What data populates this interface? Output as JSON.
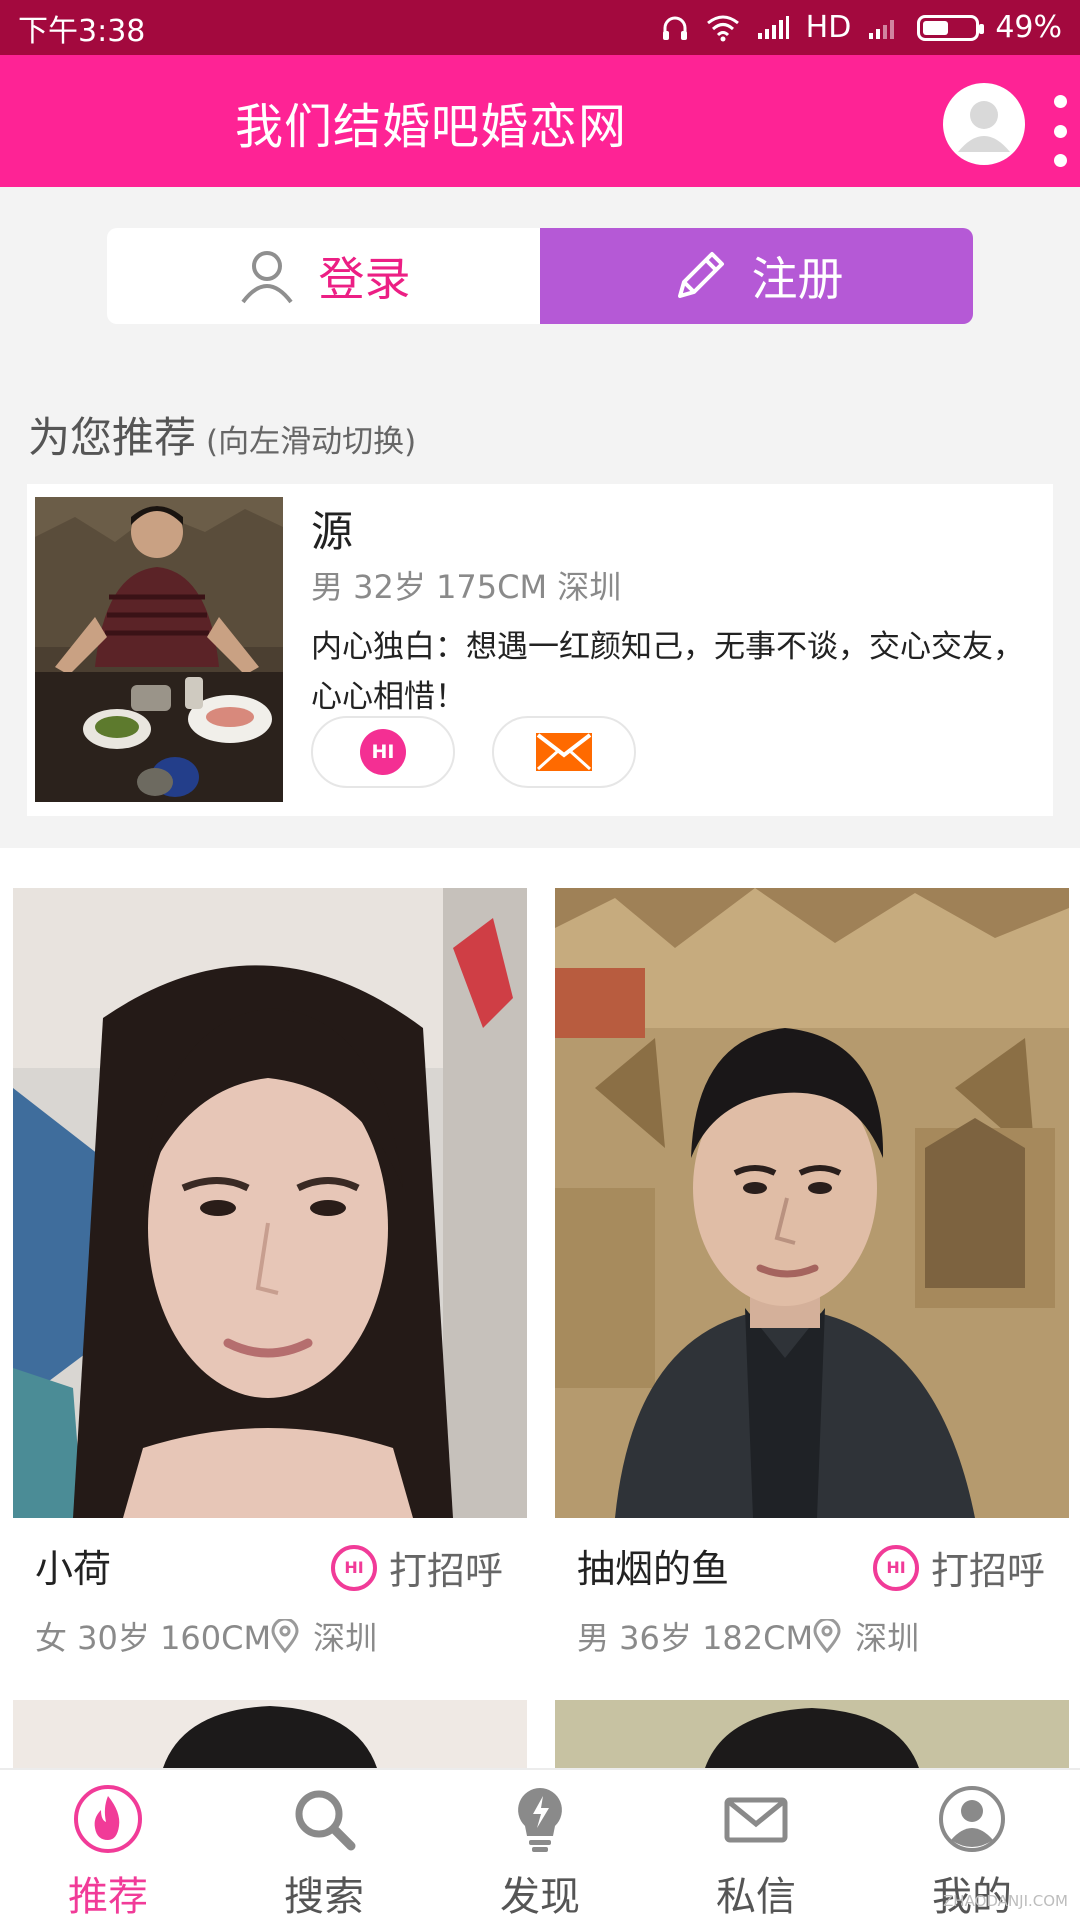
{
  "status_bar": {
    "time": "下午3:38",
    "network": "HD",
    "battery": "49%",
    "battery_level": 0.49
  },
  "header": {
    "title": "我们结婚吧婚恋网"
  },
  "auth": {
    "login_label": "登录",
    "register_label": "注册"
  },
  "recommend": {
    "title": "为您推荐",
    "hint": "(向左滑动切换)",
    "card": {
      "name": "源",
      "meta": "男 32岁 175CM 深圳",
      "bio": "内心独白：想遇一红颜知己，无事不谈，交心交友，心心相惜！",
      "hi_label": "HI"
    }
  },
  "profiles": [
    {
      "name": "小荷",
      "greet_label": "打招呼",
      "hi_label": "HI",
      "meta": "女 30岁 160CM",
      "city": "深圳"
    },
    {
      "name": "抽烟的鱼",
      "greet_label": "打招呼",
      "hi_label": "HI",
      "meta": "男 36岁 182CM",
      "city": "深圳"
    }
  ],
  "nav": [
    {
      "label": "推荐",
      "icon": "flame-icon",
      "active": true
    },
    {
      "label": "搜索",
      "icon": "search-icon"
    },
    {
      "label": "发现",
      "icon": "lightbulb-icon"
    },
    {
      "label": "私信",
      "icon": "mail-icon"
    },
    {
      "label": "我的",
      "icon": "user-icon"
    }
  ],
  "watermark": "ZHAODANJI.COM",
  "colors": {
    "status_bar": "#a3093e",
    "header": "#fe2395",
    "register_button": "#b559d6",
    "accent_pink": "#f13b98",
    "mail_orange": "#ff6a00"
  }
}
